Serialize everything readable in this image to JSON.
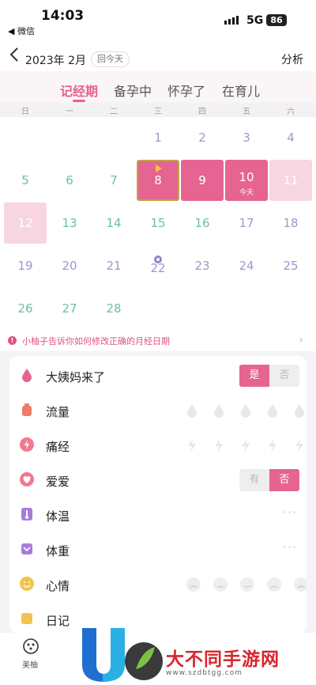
{
  "status_bar": {
    "time": "14:03",
    "back_app": "◀ 微信",
    "network": "5G",
    "battery": "86"
  },
  "header": {
    "month": "2023年 2月",
    "today_button": "回今天",
    "analyze": "分析"
  },
  "tabs": [
    {
      "label": "记经期",
      "active": true
    },
    {
      "label": "备孕中",
      "active": false
    },
    {
      "label": "怀孕了",
      "active": false
    },
    {
      "label": "在育儿",
      "active": false
    }
  ],
  "weekdays": [
    "日",
    "一",
    "二",
    "三",
    "四",
    "五",
    "六"
  ],
  "calendar": {
    "today_label": "今天",
    "days": [
      {
        "day": "1",
        "color": "#9a9acb"
      },
      {
        "day": "2",
        "color": "#9a9acb"
      },
      {
        "day": "3",
        "color": "#9a9acb"
      },
      {
        "day": "4",
        "color": "#9a9acb"
      },
      {
        "day": "5",
        "color": "#6cc0a0"
      },
      {
        "day": "6",
        "color": "#6cc0a0"
      },
      {
        "day": "7",
        "color": "#6cc0a0"
      },
      {
        "day": "8",
        "color": "#ffffff"
      },
      {
        "day": "9",
        "color": "#ffffff"
      },
      {
        "day": "10",
        "color": "#ffffff"
      },
      {
        "day": "11",
        "color": "#ffffff"
      },
      {
        "day": "12",
        "color": "#ffffff"
      },
      {
        "day": "13",
        "color": "#6cc0a0"
      },
      {
        "day": "14",
        "color": "#6cc0a0"
      },
      {
        "day": "15",
        "color": "#6cc0a0"
      },
      {
        "day": "16",
        "color": "#6cc0a0"
      },
      {
        "day": "17",
        "color": "#9a9acb"
      },
      {
        "day": "18",
        "color": "#9a9acb"
      },
      {
        "day": "19",
        "color": "#9a9acb"
      },
      {
        "day": "20",
        "color": "#9a9acb"
      },
      {
        "day": "21",
        "color": "#9a9acb"
      },
      {
        "day": "22",
        "color": "#9a9acb"
      },
      {
        "day": "23",
        "color": "#9a9acb"
      },
      {
        "day": "24",
        "color": "#9a9acb"
      },
      {
        "day": "25",
        "color": "#9a9acb"
      },
      {
        "day": "26",
        "color": "#6cc0a0"
      },
      {
        "day": "27",
        "color": "#6cc0a0"
      },
      {
        "day": "28",
        "color": "#6cc0a0"
      }
    ]
  },
  "tip": {
    "text": "小柚子告诉你如何修改正确的月经日期"
  },
  "records": [
    {
      "label": "大姨妈来了",
      "yes": "是",
      "no": "否",
      "selected": "yes"
    },
    {
      "label": "流量"
    },
    {
      "label": "痛经"
    },
    {
      "label": "爱爱",
      "yes": "有",
      "no": "否",
      "selected": "no"
    },
    {
      "label": "体温",
      "more": "···"
    },
    {
      "label": "体重",
      "more": "···"
    },
    {
      "label": "心情"
    },
    {
      "label": "日记"
    }
  ],
  "bottom_nav": {
    "label": "美柚"
  },
  "watermark": {
    "text": "大不同手游网",
    "url": "www.szdbtgg.com"
  },
  "colors": {
    "accent": "#e56492",
    "period_light": "#f7d6e0",
    "fertile": "#6cc0a0",
    "normal_day": "#9a9acb",
    "tip": "#e0557a"
  }
}
